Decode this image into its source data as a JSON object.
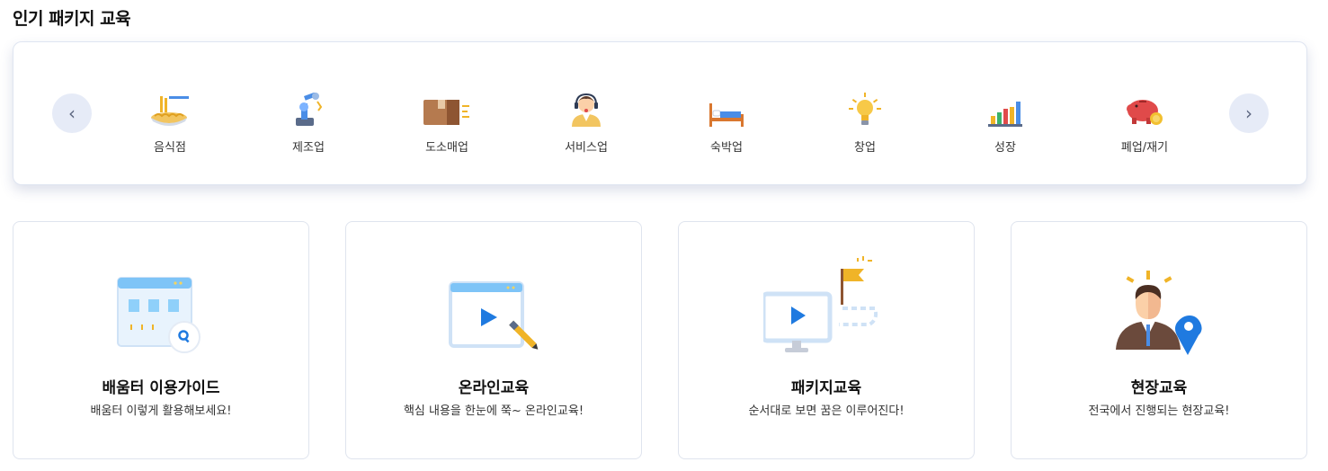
{
  "section": {
    "title": "인기 패키지 교육"
  },
  "category_nav": {
    "prev_symbol": "‹",
    "next_symbol": "›"
  },
  "categories": [
    {
      "label": "음식점",
      "icon": "noodle-bowl-icon"
    },
    {
      "label": "제조업",
      "icon": "robot-arm-icon"
    },
    {
      "label": "도소매업",
      "icon": "delivery-box-icon"
    },
    {
      "label": "서비스업",
      "icon": "headset-agent-icon"
    },
    {
      "label": "숙박업",
      "icon": "bed-icon"
    },
    {
      "label": "창업",
      "icon": "lightbulb-icon"
    },
    {
      "label": "성장",
      "icon": "bar-chart-icon"
    },
    {
      "label": "폐업/재기",
      "icon": "piggy-bank-icon"
    }
  ],
  "cards": [
    {
      "title": "배움터 이용가이드",
      "desc": "배움터 이렇게 활용해보세요!",
      "icon": "browser-search-icon"
    },
    {
      "title": "온라인교육",
      "desc": "핵심 내용을 한눈에 쭉~ 온라인교육!",
      "icon": "video-pencil-icon"
    },
    {
      "title": "패키지교육",
      "desc": "순서대로 보면 꿈은 이루어진다!",
      "icon": "monitor-flag-icon"
    },
    {
      "title": "현장교육",
      "desc": "전국에서 진행되는 현장교육!",
      "icon": "person-location-icon"
    }
  ],
  "colors": {
    "accent_blue": "#1f7ae0",
    "nav_bg": "#e6ebf7",
    "card_border": "#dfe4ee"
  }
}
